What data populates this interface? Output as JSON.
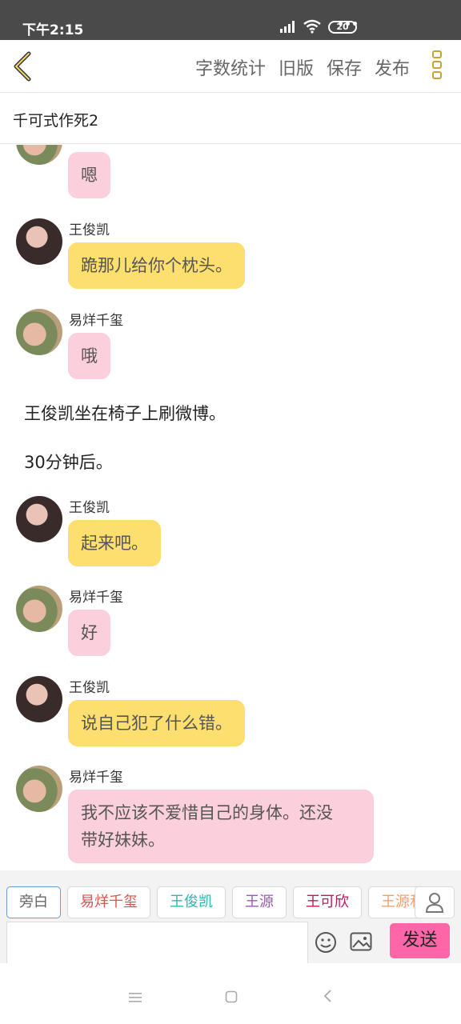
{
  "status_bar": {
    "time": "下午2:15",
    "battery": "20"
  },
  "toolbar": {
    "word_count": "字数统计",
    "old_version": "旧版",
    "save": "保存",
    "publish": "发布"
  },
  "story": {
    "title": "千可式作死2"
  },
  "messages": [
    {
      "type": "bubble",
      "speaker": "",
      "color": "pink",
      "text": "嗯"
    },
    {
      "type": "bubble",
      "speaker": "王俊凯",
      "color": "yellow",
      "text": "跪那儿给你个枕头。"
    },
    {
      "type": "bubble",
      "speaker": "易烊千玺",
      "color": "pink",
      "text": "哦"
    },
    {
      "type": "narration",
      "text": "王俊凯坐在椅子上刷微博。"
    },
    {
      "type": "narration",
      "text": "30分钟后。"
    },
    {
      "type": "bubble",
      "speaker": "王俊凯",
      "color": "yellow",
      "text": "起来吧。"
    },
    {
      "type": "bubble",
      "speaker": "易烊千玺",
      "color": "pink",
      "text": "好"
    },
    {
      "type": "bubble",
      "speaker": "王俊凯",
      "color": "yellow",
      "text": "说自己犯了什么错。"
    },
    {
      "type": "bubble",
      "speaker": "易烊千玺",
      "color": "pink",
      "text_line1": "我不应该不爱惜自己的身体。还没",
      "text_line2": "带好妹妹。"
    }
  ],
  "roles": [
    {
      "label": "旁白",
      "color": "#666666"
    },
    {
      "label": "易烊千玺",
      "color": "#d9534f"
    },
    {
      "label": "王俊凯",
      "color": "#2fb6b0"
    },
    {
      "label": "王源",
      "color": "#9b59b6"
    },
    {
      "label": "王可欣",
      "color": "#c2185b"
    },
    {
      "label": "王源和",
      "color": "#f0a070"
    }
  ],
  "input": {
    "placeholder": "",
    "send": "发送"
  },
  "colors": {
    "yellow_bubble": "#fcdf6e",
    "pink_bubble": "#fbcfdc",
    "send_button": "#ff66a8",
    "accent": "#c7a330"
  },
  "icons": [
    "back-icon",
    "more-icon",
    "emoji-icon",
    "image-icon",
    "user-icon",
    "menu-icon",
    "home-icon",
    "nav-back-icon"
  ]
}
